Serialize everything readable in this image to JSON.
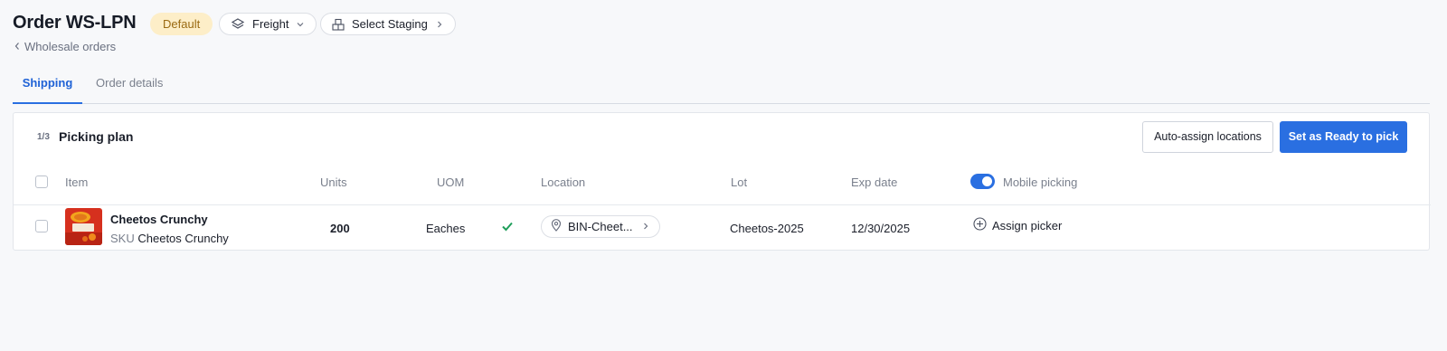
{
  "header": {
    "title": "Order WS-LPN",
    "badge": "Default",
    "freight_label": "Freight",
    "staging_label": "Select Staging",
    "back_link": "Wholesale orders"
  },
  "tabs": [
    {
      "label": "Shipping",
      "active": true
    },
    {
      "label": "Order details",
      "active": false
    }
  ],
  "picking_plan": {
    "step": "1/3",
    "title": "Picking plan",
    "auto_assign_label": "Auto-assign locations",
    "ready_label": "Set as Ready to pick",
    "columns": {
      "item": "Item",
      "units": "Units",
      "uom": "UOM",
      "location": "Location",
      "lot": "Lot",
      "exp_date": "Exp date",
      "mobile_picking": "Mobile picking"
    },
    "mobile_picking_enabled": true,
    "rows": [
      {
        "name": "Cheetos Crunchy",
        "sku_label": "SKU",
        "sku": "Cheetos Crunchy",
        "units": "200",
        "uom": "Eaches",
        "location": "BIN-Cheet...",
        "lot": "Cheetos-2025",
        "exp_date": "12/30/2025",
        "assign_label": "Assign picker"
      }
    ]
  },
  "colors": {
    "accent": "#2a6fe1",
    "badge_bg": "#fdeec8",
    "badge_text": "#9a6a12",
    "success": "#1e9e5a"
  }
}
